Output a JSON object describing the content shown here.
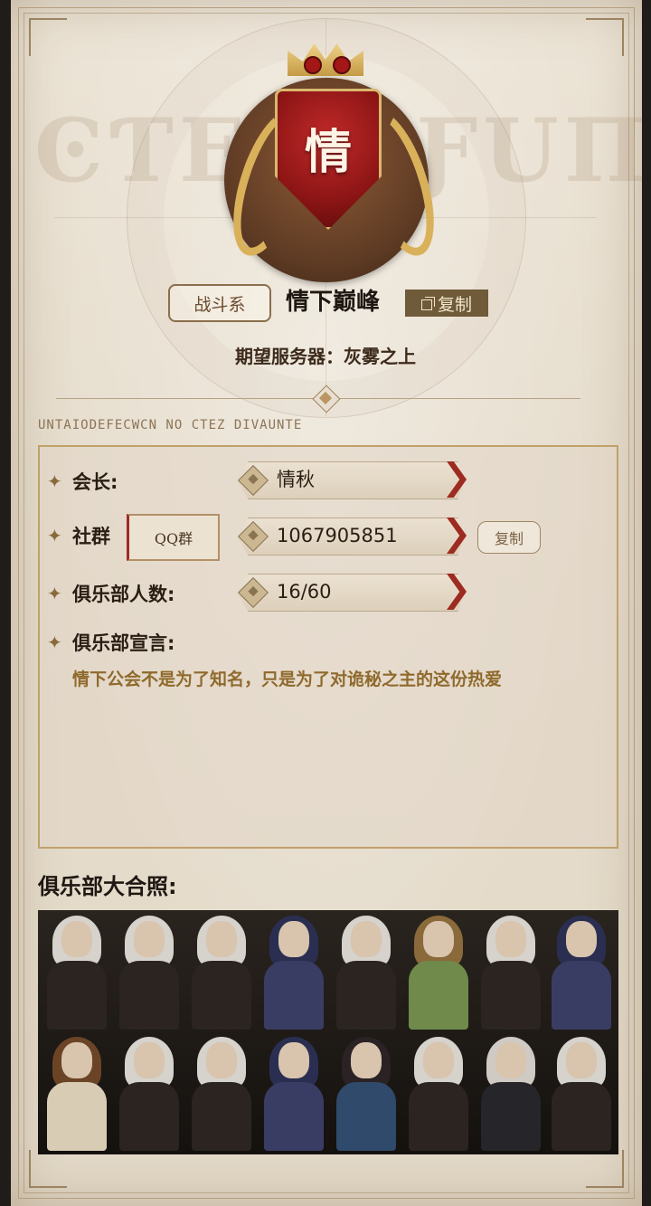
{
  "club": {
    "emblem_char": "情",
    "type_tag": "战斗系",
    "name": "情下巅峰",
    "copy_label": "复制",
    "server_line": "期望服务器：灰雾之上",
    "motto": "UNTAIODEFECWCN NO CTEZ DIVAUNTE"
  },
  "info": {
    "leader_label": "会长:",
    "leader_value": "情秋",
    "community_label": "社群",
    "community_button": "QQ群",
    "community_value": "1067905851",
    "community_copy": "复制",
    "members_label": "俱乐部人数:",
    "members_value": "16/60",
    "declaration_label": "俱乐部宣言:",
    "declaration_text": "情下公会不是为了知名，只是为了对诡秘之主的这份热爱"
  },
  "photo": {
    "title": "俱乐部大合照:"
  },
  "colors": {
    "accent_red": "#9c2b22",
    "gold": "#c1a06b",
    "paper": "#e8dfd0"
  },
  "icons": [
    "copy-icon",
    "star-icon",
    "diamond-icon",
    "laurel-icon",
    "crown-icon"
  ]
}
